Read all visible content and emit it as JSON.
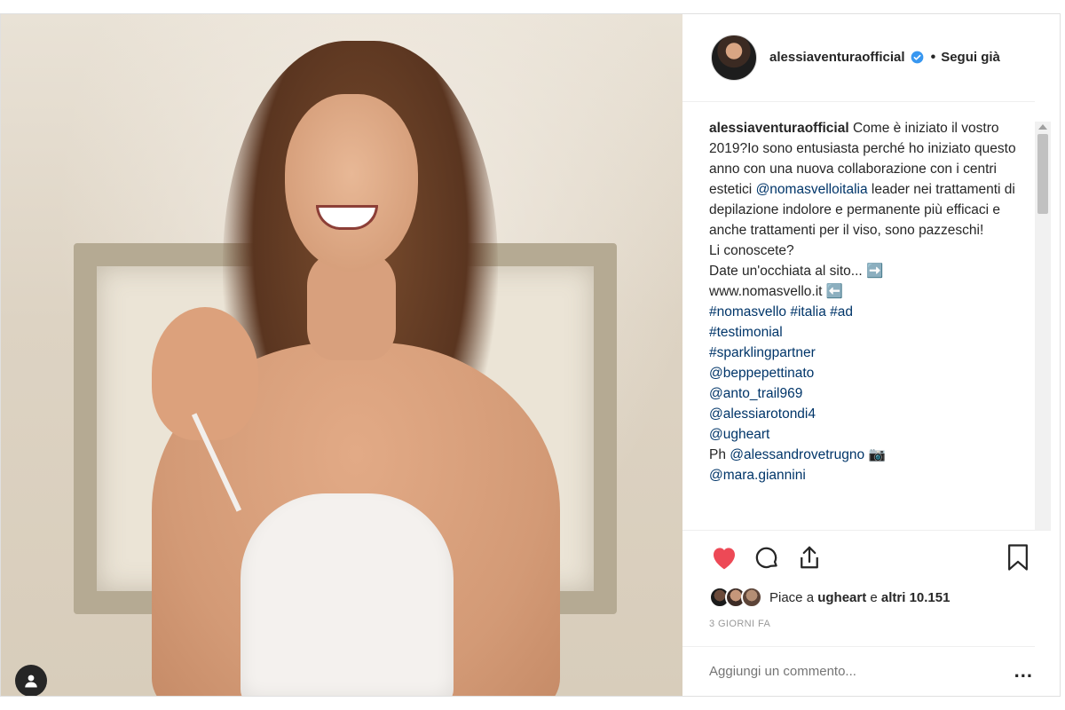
{
  "post": {
    "username": "alessiaventuraofficial",
    "follow_status": "Segui già",
    "dot": "•"
  },
  "caption": {
    "author": "alessiaventuraofficial",
    "lines": [
      {
        "text": " Come è iniziato il vostro 2019?",
        "type": "text"
      },
      {
        "text": "Io sono entusiasta perché ho iniziato questo anno con una nuova collaborazione con i centri estetici ",
        "type": "text"
      },
      {
        "text": "@nomasvelloitalia",
        "type": "tag"
      },
      {
        "text": " leader nei trattamenti di depilazione indolore e permanente più efficaci e anche trattamenti per il viso, sono pazzeschi!\nLi conoscete?\nDate un'occhiata al sito... ➡️\nwww.nomasvello.it ⬅️\n",
        "type": "text"
      },
      {
        "text": "#nomasvello",
        "type": "tag"
      },
      {
        "text": " ",
        "type": "text"
      },
      {
        "text": "#italia",
        "type": "tag"
      },
      {
        "text": " ",
        "type": "text"
      },
      {
        "text": "#ad",
        "type": "tag"
      },
      {
        "text": "\n",
        "type": "text"
      },
      {
        "text": "#testimonial",
        "type": "tag"
      },
      {
        "text": "\n",
        "type": "text"
      },
      {
        "text": "#sparklingpartner",
        "type": "tag"
      },
      {
        "text": "\n",
        "type": "text"
      },
      {
        "text": "@beppepettinato",
        "type": "tag"
      },
      {
        "text": "\n",
        "type": "text"
      },
      {
        "text": "@anto_trail969",
        "type": "tag"
      },
      {
        "text": "\n",
        "type": "text"
      },
      {
        "text": "@alessiarotondi4",
        "type": "tag"
      },
      {
        "text": "\n",
        "type": "text"
      },
      {
        "text": "@ugheart",
        "type": "tag"
      },
      {
        "text": "\nPh ",
        "type": "text"
      },
      {
        "text": "@alessandrovetrugno",
        "type": "tag"
      },
      {
        "text": " 📷\n",
        "type": "text"
      },
      {
        "text": "@mara.giannini",
        "type": "tag"
      }
    ]
  },
  "likes": {
    "prefix": "Piace a ",
    "user": "ugheart",
    "middle": " e ",
    "count": "altri 10.151"
  },
  "time": "3 GIORNI FA",
  "comment": {
    "placeholder": "Aggiungi un commento...",
    "more": "..."
  },
  "icons": {
    "like": "heart-icon",
    "comment": "comment-icon",
    "share": "share-icon",
    "save": "bookmark-icon",
    "verified": "verified-badge-icon",
    "user_tag": "user-tag-icon"
  },
  "colors": {
    "like": "#ed4956",
    "verified": "#3897f0",
    "link": "#003569",
    "muted": "#999999"
  }
}
